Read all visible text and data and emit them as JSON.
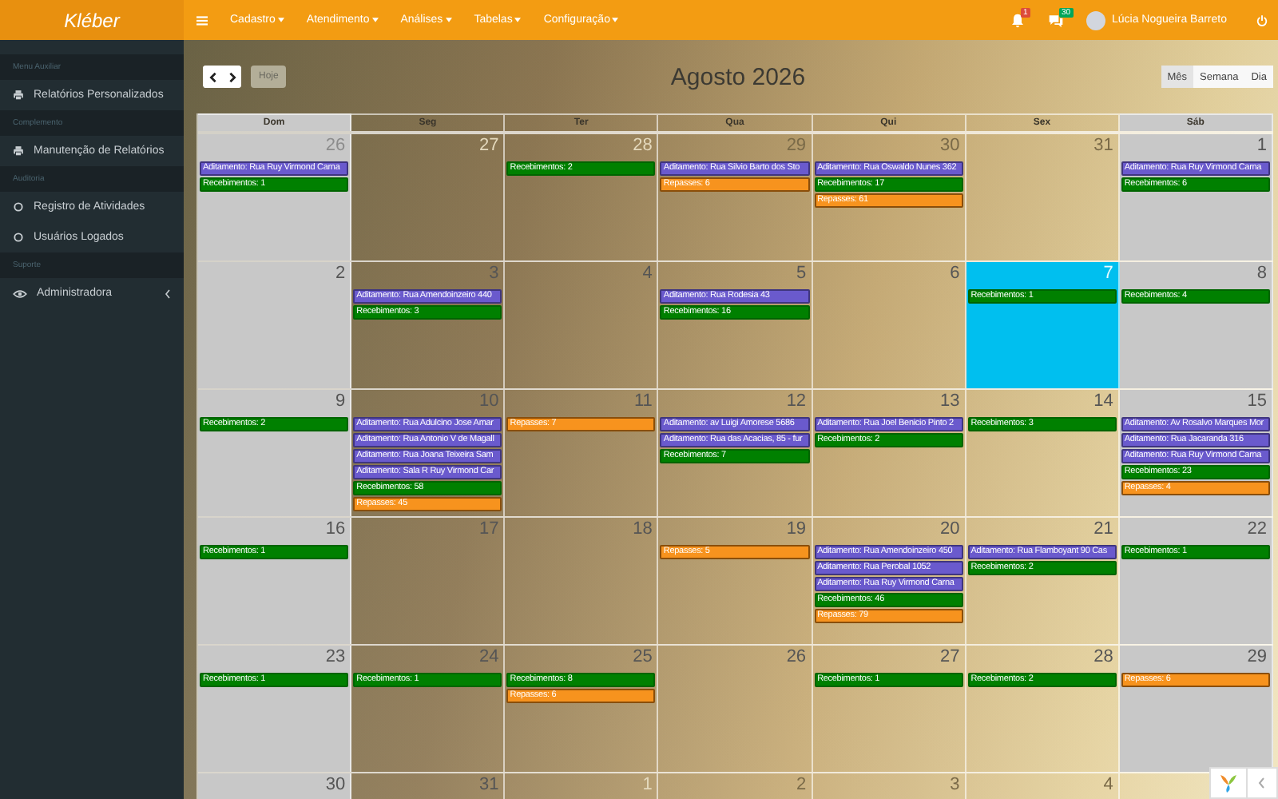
{
  "topbar": {
    "logo": "Kléber",
    "menus": [
      {
        "label": "Cadastro"
      },
      {
        "label": "Atendimento"
      },
      {
        "label": "Análises"
      },
      {
        "label": "Tabelas"
      },
      {
        "label": "Configuração"
      }
    ],
    "notifications": [
      {
        "kind": "bell",
        "count": "1",
        "color": "#dd4b39"
      },
      {
        "kind": "chat",
        "count": "30",
        "color": "#00a65a"
      }
    ],
    "user": "Lúcia Nogueira Barreto"
  },
  "sidebar": [
    {
      "header": "Menu Auxiliar",
      "items": [
        {
          "label": "Relatórios Personalizados",
          "kind": "report"
        }
      ]
    },
    {
      "header": "Complemento",
      "items": [
        {
          "label": "Manutenção de Relatórios",
          "kind": "report"
        }
      ]
    },
    {
      "header": "Auditoria",
      "items": [
        {
          "label": "Registro de Atividades",
          "kind": "audit"
        },
        {
          "label": "Usuários Logados",
          "kind": "audit"
        }
      ]
    },
    {
      "header": "Suporte",
      "items": [
        {
          "label": "Administradora",
          "kind": "admin"
        }
      ]
    }
  ],
  "toolbar": {
    "today": {
      "label": "Hoje",
      "disabled": true
    },
    "title": "Agosto 2026",
    "views": [
      {
        "label": "Mês",
        "selected": true
      },
      {
        "label": "Semana",
        "selected": false
      },
      {
        "label": "Dia",
        "selected": false
      }
    ]
  },
  "weekdays": [
    "Dom",
    "Seg",
    "Ter",
    "Qua",
    "Qui",
    "Sex",
    "Sáb"
  ],
  "weeks": [
    {
      "days": [
        {
          "day": "26",
          "muted": true,
          "today": false,
          "events": [
            {
              "kind": "aditamento",
              "text": "Aditamento: Rua Ruy Virmond Carna"
            },
            {
              "kind": "recebimentos",
              "text": "Recebimentos: 1"
            }
          ]
        },
        {
          "day": "27",
          "muted": true,
          "today": false
        },
        {
          "day": "28",
          "muted": true,
          "today": false,
          "events": [
            {
              "kind": "recebimentos",
              "text": "Recebimentos: 2"
            }
          ]
        },
        {
          "day": "29",
          "muted": true,
          "today": false,
          "events": [
            {
              "kind": "aditamento",
              "text": "Aditamento: Rua Silvio Barto dos Sto"
            },
            {
              "kind": "repasses",
              "text": "Repasses: 6"
            }
          ]
        },
        {
          "day": "30",
          "muted": true,
          "today": false,
          "events": [
            {
              "kind": "aditamento",
              "text": "Aditamento: Rua Oswaldo Nunes 362"
            },
            {
              "kind": "recebimentos",
              "text": "Recebimentos: 17"
            },
            {
              "kind": "repasses",
              "text": "Repasses: 61"
            }
          ]
        },
        {
          "day": "31",
          "muted": true,
          "today": false
        },
        {
          "day": "1",
          "muted": false,
          "today": false,
          "events": [
            {
              "kind": "aditamento",
              "text": "Aditamento: Rua Ruy Virmond Carna"
            },
            {
              "kind": "recebimentos",
              "text": "Recebimentos: 6"
            }
          ]
        }
      ]
    },
    {
      "days": [
        {
          "day": "2",
          "muted": false,
          "today": false
        },
        {
          "day": "3",
          "muted": false,
          "today": false,
          "events": [
            {
              "kind": "aditamento",
              "text": "Aditamento: Rua Amendoinzeiro 440"
            },
            {
              "kind": "recebimentos",
              "text": "Recebimentos: 3"
            }
          ]
        },
        {
          "day": "4",
          "muted": false,
          "today": false
        },
        {
          "day": "5",
          "muted": false,
          "today": false,
          "events": [
            {
              "kind": "aditamento",
              "text": "Aditamento: Rua Rodesia 43"
            },
            {
              "kind": "recebimentos",
              "text": "Recebimentos: 16"
            }
          ]
        },
        {
          "day": "6",
          "muted": false,
          "today": false
        },
        {
          "day": "7",
          "muted": false,
          "today": true,
          "events": [
            {
              "kind": "recebimentos",
              "text": "Recebimentos: 1"
            }
          ]
        },
        {
          "day": "8",
          "muted": false,
          "today": false,
          "events": [
            {
              "kind": "recebimentos",
              "text": "Recebimentos: 4"
            }
          ]
        }
      ]
    },
    {
      "days": [
        {
          "day": "9",
          "muted": false,
          "today": false,
          "events": [
            {
              "kind": "recebimentos",
              "text": "Recebimentos: 2"
            }
          ]
        },
        {
          "day": "10",
          "muted": false,
          "today": false,
          "events": [
            {
              "kind": "aditamento",
              "text": "Aditamento: Rua Adulcino Jose Amar"
            },
            {
              "kind": "aditamento",
              "text": "Aditamento: Rua Antonio V de Magall"
            },
            {
              "kind": "aditamento",
              "text": "Aditamento: Rua Joana Teixeira Sam"
            },
            {
              "kind": "aditamento",
              "text": "Aditamento: Sala R Ruy Virmond Car"
            },
            {
              "kind": "recebimentos",
              "text": "Recebimentos: 58"
            },
            {
              "kind": "repasses",
              "text": "Repasses: 45"
            }
          ]
        },
        {
          "day": "11",
          "muted": false,
          "today": false,
          "events": [
            {
              "kind": "repasses",
              "text": "Repasses: 7"
            }
          ]
        },
        {
          "day": "12",
          "muted": false,
          "today": false,
          "events": [
            {
              "kind": "aditamento",
              "text": "Aditamento: av Luigi Amorese 5686"
            },
            {
              "kind": "aditamento",
              "text": "Aditamento: Rua das Acacias, 85 - fur"
            },
            {
              "kind": "recebimentos",
              "text": "Recebimentos: 7"
            }
          ]
        },
        {
          "day": "13",
          "muted": false,
          "today": false,
          "events": [
            {
              "kind": "aditamento",
              "text": "Aditamento: Rua Joel Benicio Pinto 2"
            },
            {
              "kind": "recebimentos",
              "text": "Recebimentos: 2"
            }
          ]
        },
        {
          "day": "14",
          "muted": false,
          "today": false,
          "events": [
            {
              "kind": "recebimentos",
              "text": "Recebimentos: 3"
            }
          ]
        },
        {
          "day": "15",
          "muted": false,
          "today": false,
          "events": [
            {
              "kind": "aditamento",
              "text": "Aditamento: Av Rosalvo Marques Mor"
            },
            {
              "kind": "aditamento",
              "text": "Aditamento: Rua Jacaranda 316"
            },
            {
              "kind": "aditamento",
              "text": "Aditamento: Rua Ruy Virmond Carna"
            },
            {
              "kind": "recebimentos",
              "text": "Recebimentos: 23"
            },
            {
              "kind": "repasses",
              "text": "Repasses: 4"
            }
          ]
        }
      ]
    },
    {
      "days": [
        {
          "day": "16",
          "muted": false,
          "today": false,
          "events": [
            {
              "kind": "recebimentos",
              "text": "Recebimentos: 1"
            }
          ]
        },
        {
          "day": "17",
          "muted": false,
          "today": false
        },
        {
          "day": "18",
          "muted": false,
          "today": false
        },
        {
          "day": "19",
          "muted": false,
          "today": false,
          "events": [
            {
              "kind": "repasses",
              "text": "Repasses: 5"
            }
          ]
        },
        {
          "day": "20",
          "muted": false,
          "today": false,
          "events": [
            {
              "kind": "aditamento",
              "text": "Aditamento: Rua Amendoinzeiro 450"
            },
            {
              "kind": "aditamento",
              "text": "Aditamento: Rua Perobal 1052"
            },
            {
              "kind": "aditamento",
              "text": "Aditamento: Rua Ruy Virmond Carna"
            },
            {
              "kind": "recebimentos",
              "text": "Recebimentos: 46"
            },
            {
              "kind": "repasses",
              "text": "Repasses: 79"
            }
          ]
        },
        {
          "day": "21",
          "muted": false,
          "today": false,
          "events": [
            {
              "kind": "aditamento",
              "text": "Aditamento: Rua Flamboyant 90 Cas"
            },
            {
              "kind": "recebimentos",
              "text": "Recebimentos: 2"
            }
          ]
        },
        {
          "day": "22",
          "muted": false,
          "today": false,
          "events": [
            {
              "kind": "recebimentos",
              "text": "Recebimentos: 1"
            }
          ]
        }
      ]
    },
    {
      "days": [
        {
          "day": "23",
          "muted": false,
          "today": false,
          "events": [
            {
              "kind": "recebimentos",
              "text": "Recebimentos: 1"
            }
          ]
        },
        {
          "day": "24",
          "muted": false,
          "today": false,
          "events": [
            {
              "kind": "recebimentos",
              "text": "Recebimentos: 1"
            }
          ]
        },
        {
          "day": "25",
          "muted": false,
          "today": false,
          "events": [
            {
              "kind": "recebimentos",
              "text": "Recebimentos: 8"
            },
            {
              "kind": "repasses",
              "text": "Repasses: 6"
            }
          ]
        },
        {
          "day": "26",
          "muted": false,
          "today": false
        },
        {
          "day": "27",
          "muted": false,
          "today": false,
          "events": [
            {
              "kind": "recebimentos",
              "text": "Recebimentos: 1"
            }
          ]
        },
        {
          "day": "28",
          "muted": false,
          "today": false,
          "events": [
            {
              "kind": "recebimentos",
              "text": "Recebimentos: 2"
            }
          ]
        },
        {
          "day": "29",
          "muted": false,
          "today": false,
          "events": [
            {
              "kind": "repasses",
              "text": "Repasses: 6"
            }
          ]
        }
      ]
    },
    {
      "days": [
        {
          "day": "30",
          "muted": false,
          "today": false
        },
        {
          "day": "31",
          "muted": false,
          "today": false
        },
        {
          "day": "1",
          "muted": true,
          "today": false
        },
        {
          "day": "2",
          "muted": true,
          "today": false
        },
        {
          "day": "3",
          "muted": true,
          "today": false
        },
        {
          "day": "4",
          "muted": true,
          "today": false
        }
      ]
    }
  ]
}
